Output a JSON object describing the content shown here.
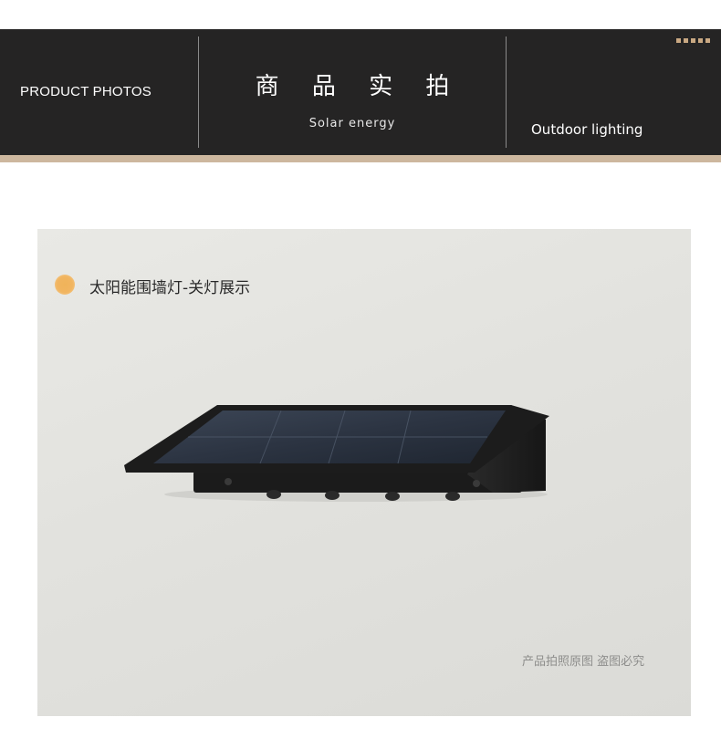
{
  "header": {
    "left_label": "PRODUCT PHOTOS",
    "title": "商 品 实 拍",
    "subtitle": "Solar energy",
    "right_label": "Outdoor lighting"
  },
  "photo": {
    "caption": "太阳能围墙灯-关灯展示",
    "watermark": "产品拍照原图 盗图必究"
  },
  "colors": {
    "banner": "#252424",
    "strip": "#cdb79e",
    "accent_dot": "#f1b560"
  }
}
